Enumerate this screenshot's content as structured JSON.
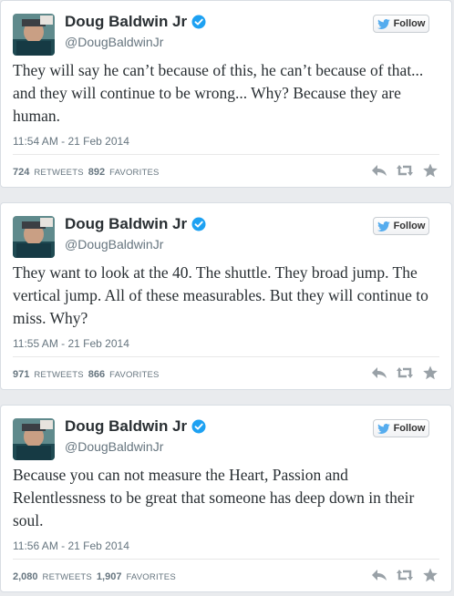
{
  "tweets": [
    {
      "name": "Doug Baldwin Jr",
      "handle": "@DougBaldwinJr",
      "follow_label": "Follow",
      "text": "They will say he can’t because of this, he can’t because of that... and they will continue to be wrong... Why? Because they are human.",
      "time": "11:54 AM - 21 Feb 2014",
      "retweets": "724",
      "retweets_label": "RETWEETS",
      "favorites": "892",
      "favorites_label": "FAVORITES"
    },
    {
      "name": "Doug Baldwin Jr",
      "handle": "@DougBaldwinJr",
      "follow_label": "Follow",
      "text": "They want to look at the 40. The shuttle. They broad jump. The vertical jump. All of these measurables. But they will continue to miss. Why?",
      "time": "11:55 AM - 21 Feb 2014",
      "retweets": "971",
      "retweets_label": "RETWEETS",
      "favorites": "866",
      "favorites_label": "FAVORITES"
    },
    {
      "name": "Doug Baldwin Jr",
      "handle": "@DougBaldwinJr",
      "follow_label": "Follow",
      "text": "Because you can not measure the Heart, Passion and Relentlessness to be great that someone has deep down in their soul.",
      "time": "11:56 AM - 21 Feb 2014",
      "retweets": "2,080",
      "retweets_label": "RETWEETS",
      "favorites": "1,907",
      "favorites_label": "FAVORITES"
    }
  ],
  "colors": {
    "verified": "#1da1f2",
    "bird": "#55acee",
    "icons": "#99a1a7"
  },
  "icons": {
    "verified": "verified-badge-icon",
    "bird": "twitter-bird-icon",
    "reply": "reply-icon",
    "retweet": "retweet-icon",
    "favorite": "star-icon"
  }
}
